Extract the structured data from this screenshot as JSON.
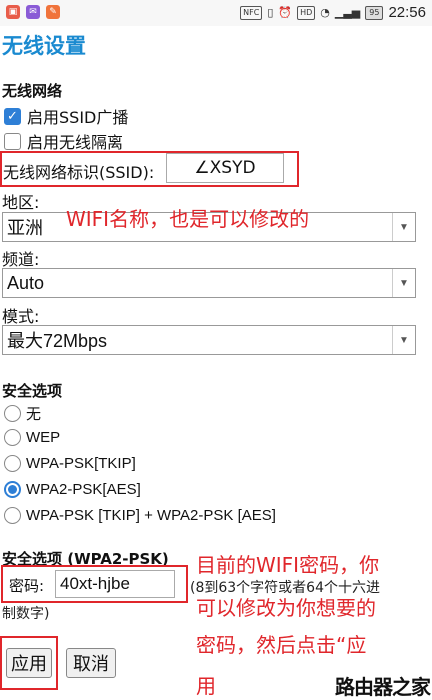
{
  "status_bar": {
    "icons_left": [
      "app-icon",
      "mail-icon",
      "app-icon"
    ],
    "nfc": "NFC",
    "hd": "HD",
    "battery": "95",
    "time": "22:56"
  },
  "page": {
    "title": "无线设置",
    "wireless_section": "无线网络",
    "enable_ssid_broadcast": {
      "label": "启用SSID广播",
      "checked": true
    },
    "enable_isolation": {
      "label": "启用无线隔离",
      "checked": false
    },
    "ssid_label": "无线网络标识(SSID):",
    "ssid_value": "∠XSYD",
    "region_label": "地区:",
    "region_value": "亚洲",
    "channel_label": "频道:",
    "channel_value": "Auto",
    "mode_label": "模式:",
    "mode_value": "最大72Mbps",
    "security_section": "安全选项",
    "security_options": [
      "无",
      "WEP",
      "WPA-PSK[TKIP]",
      "WPA2-PSK[AES]",
      "WPA-PSK [TKIP] + WPA2-PSK [AES]"
    ],
    "security_selected_index": 3,
    "wpa2_section": "安全选项 (WPA2-PSK)",
    "password_label": "密码:",
    "password_value": "40xt-hjbe",
    "password_hint_line1": "(8到63个字符或者64个十六进",
    "password_hint_line2": "制数字)",
    "apply_button": "应用",
    "cancel_button": "取消"
  },
  "annotations": {
    "ssid_note": "WIFI名称，也是可以修改的",
    "password_note_line1": "目前的WIFI密码，你",
    "password_note_line2": "可以修改为你想要的",
    "password_note_line3": "密码，然后点击“应",
    "password_note_line4": "用"
  },
  "watermark": "路由器之家",
  "colors": {
    "title": "#1a8ad0",
    "accent": "#2e7fd6",
    "annotation": "#e0262b"
  }
}
